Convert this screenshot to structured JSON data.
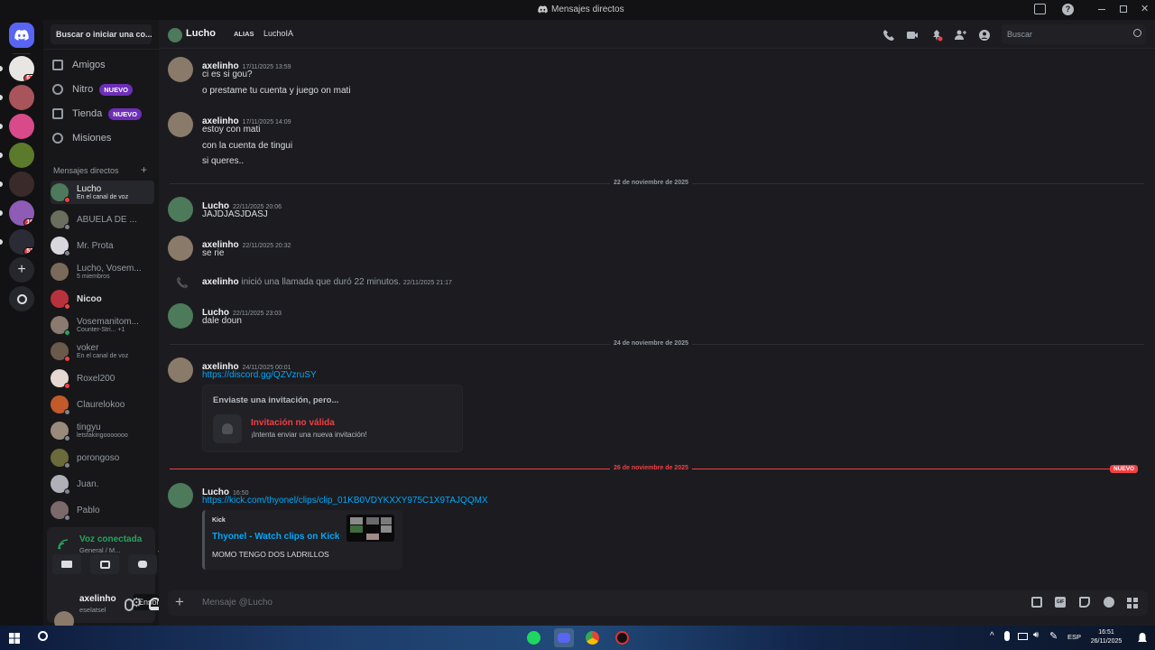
{
  "titlebar": {
    "title": "Mensajes directos"
  },
  "servers": [
    {
      "badge": "67",
      "color": "#e8e6e3"
    },
    {
      "badge": "",
      "color": "#a9545b"
    },
    {
      "badge": "",
      "color": "#d94a8a"
    },
    {
      "badge": "",
      "color": "#5b7a2b"
    },
    {
      "badge": "",
      "color": "#3a2a2a"
    },
    {
      "badge": "16",
      "color": "#8e5bb5"
    },
    {
      "badge": "51",
      "color": "#2b2b36"
    }
  ],
  "sidebar": {
    "search_placeholder": "Buscar o iniciar una co...",
    "nav": [
      {
        "label": "Amigos",
        "pill": ""
      },
      {
        "label": "Nitro",
        "pill": "NUEVO"
      },
      {
        "label": "Tienda",
        "pill": "NUEVO"
      },
      {
        "label": "Misiones",
        "pill": ""
      }
    ],
    "dm_header": "Mensajes directos",
    "dms": [
      {
        "name": "Lucho",
        "sub": "En el canal de voz",
        "status": "#f23f43",
        "color": "#4d7a5a"
      },
      {
        "name": "ABUELA DE ...",
        "sub": "",
        "status": "#80848e",
        "color": "#6a6e5c"
      },
      {
        "name": "Mr. Prota",
        "sub": "",
        "status": "#80848e",
        "color": "#d7d7dd"
      },
      {
        "name": "Lucho, Vosem...",
        "sub": "5 miembros",
        "status": "",
        "color": "#7a6a5a"
      },
      {
        "name": "Nicoo",
        "sub": "",
        "status": "#f23f43",
        "color": "#b8323c"
      },
      {
        "name": "Vosemanitom...",
        "sub": "Counter-Stri...  +1",
        "status": "#23a55a",
        "color": "#8a7a70"
      },
      {
        "name": "voker",
        "sub": "En el canal de voz",
        "status": "#f23f43",
        "color": "#6a5a4a"
      },
      {
        "name": "Roxel200",
        "sub": "",
        "status": "#f23f43",
        "color": "#e6d8d0"
      },
      {
        "name": "Claurelokoo",
        "sub": "",
        "status": "#80848e",
        "color": "#c25a2a"
      },
      {
        "name": "tingyu",
        "sub": "letsfakingooooooo",
        "status": "#80848e",
        "color": "#9a8a7a"
      },
      {
        "name": "porongoso",
        "sub": "",
        "status": "#80848e",
        "color": "#6a6a3a"
      },
      {
        "name": "Juan.",
        "sub": "",
        "status": "#80848e",
        "color": "#b0b0b8"
      },
      {
        "name": "Pablo",
        "sub": "",
        "status": "#80848e",
        "color": "#7a6a6a"
      }
    ],
    "voice": {
      "title": "Voz conectada",
      "channel": "General / M..."
    },
    "tooltip": "Ensordecer",
    "user": {
      "name": "axelinho",
      "tag": "eselatsel"
    }
  },
  "header": {
    "name": "Lucho",
    "alias_label": "ALIAS",
    "alias": "LuchoIA",
    "search_placeholder": "Buscar"
  },
  "messages": [
    {
      "author": "axelinho",
      "time": "17/11/2025 13:59",
      "lines": [
        "ci es si gou?",
        "o prestame tu cuenta y juego on mati"
      ],
      "av": "#8a7a6a"
    },
    {
      "author": "axelinho",
      "time": "17/11/2025 14:09",
      "lines": [
        "estoy con mati",
        "con la cuenta de tingui",
        "si queres.."
      ],
      "av": "#8a7a6a"
    },
    {
      "author": "Lucho",
      "time": "22/11/2025 20:06",
      "lines": [
        "JAJDJASJDASJ"
      ],
      "av": "#4d7a5a"
    },
    {
      "author": "axelinho",
      "time": "22/11/2025 20:32",
      "lines": [
        "se rie"
      ],
      "av": "#8a7a6a"
    },
    {
      "author": "Lucho",
      "time": "22/11/2025 23:03",
      "lines": [
        "dale doun"
      ],
      "av": "#4d7a5a"
    },
    {
      "author": "axelinho",
      "time": "24/11/2025 00:01",
      "lines": [
        "https://discord.gg/QZVzruSY"
      ],
      "av": "#8a7a6a"
    },
    {
      "author": "Lucho",
      "time": "16:50",
      "lines": [
        "https://kick.com/thyonel/clips/clip_01KB0VDYKXXY975C1X9TAJQQMX"
      ],
      "av": "#4d7a5a"
    }
  ],
  "dividers": [
    "22 de noviembre de 2025",
    "24 de noviembre de 2025",
    "26 de noviembre de 2025"
  ],
  "new_badge": "NUEVO",
  "call": {
    "author": "axelinho",
    "text": "inició una llamada que duró 22 minutos.",
    "time": "22/11/2025 21:17"
  },
  "invite": {
    "title": "Enviaste una invitación, pero...",
    "status": "Invitación no válida",
    "hint": "¡Intenta enviar una nueva invitación!"
  },
  "embed": {
    "provider": "Kick",
    "title": "Thyonel - Watch clips on Kick",
    "desc": "MOMO TENGO DOS LADRILLOS"
  },
  "composer": {
    "placeholder": "Mensaje @Lucho"
  },
  "taskbar": {
    "lang": "ESP",
    "time": "16:51",
    "date": "26/11/2025"
  },
  "colors": {
    "accent": "#5865f2",
    "danger": "#f23f43",
    "link": "#00a8fc",
    "online": "#23a55a"
  }
}
